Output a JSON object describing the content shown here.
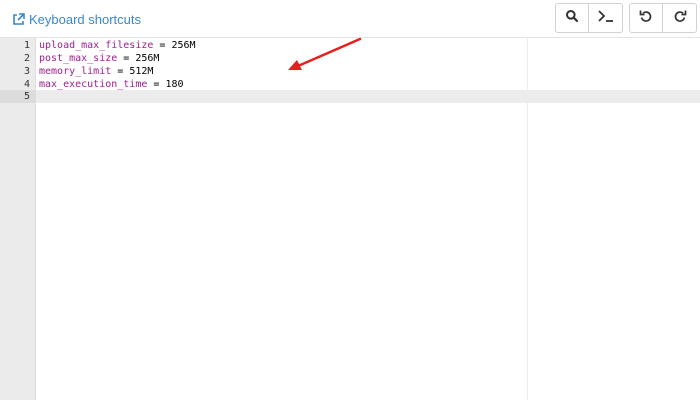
{
  "toolbar": {
    "keyboard_shortcuts_label": "Keyboard shortcuts",
    "buttons": [
      "search",
      "terminal",
      "undo",
      "redo"
    ]
  },
  "editor": {
    "lines": [
      {
        "number": "1",
        "key": "upload_max_filesize",
        "op": " = ",
        "value": "256M"
      },
      {
        "number": "2",
        "key": "post_max_size",
        "op": " = ",
        "value": "256M"
      },
      {
        "number": "3",
        "key": "memory_limit",
        "op": " = ",
        "value": "512M"
      },
      {
        "number": "4",
        "key": "max_execution_time",
        "op": " = ",
        "value": "180"
      },
      {
        "number": "5",
        "key": "",
        "op": "",
        "value": ""
      }
    ],
    "active_line": 5
  },
  "colors": {
    "link": "#3a87c8",
    "keyword": "#9b1f8e",
    "annotation_arrow": "#e5201e",
    "gutter": "#ebebeb"
  }
}
